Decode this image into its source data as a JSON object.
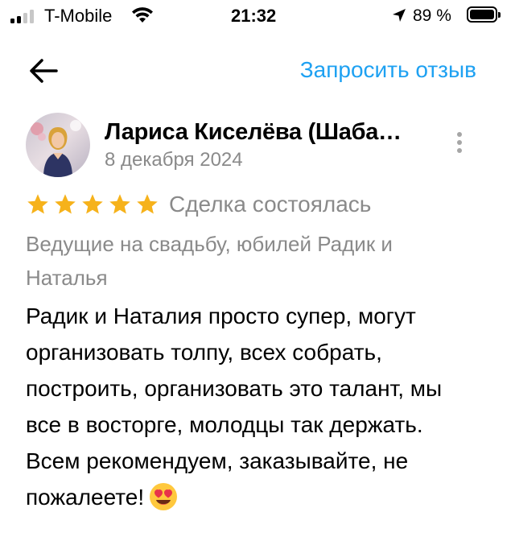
{
  "status_bar": {
    "carrier": "T-Mobile",
    "time": "21:32",
    "battery_percent": "89 %",
    "battery_level": 0.89,
    "signal_bars": 2,
    "icons": [
      "signal-icon",
      "wifi-icon",
      "location-arrow-icon",
      "battery-icon"
    ]
  },
  "header": {
    "back_icon": "arrow-left-icon",
    "request_review_label": "Запросить отзыв",
    "accent_color": "#1EA1F2"
  },
  "review": {
    "author_name": "Лариса Киселёва (Шаба…",
    "date": "8 декабря 2024",
    "rating": 5,
    "max_rating": 5,
    "star_color": "#F6B21B",
    "deal_status": "Сделка состоялась",
    "service": "Ведущие на свадьбу, юбилей Радик и Наталья",
    "text": "Радик и Наталия просто супер, могут организовать толпу, всех собрать, построить, организовать это талант, мы все в восторге, молодцы так держать. Всем рекомендуем, заказывайте, не пожалеете!",
    "emoji": "heart-eyes-emoji"
  }
}
